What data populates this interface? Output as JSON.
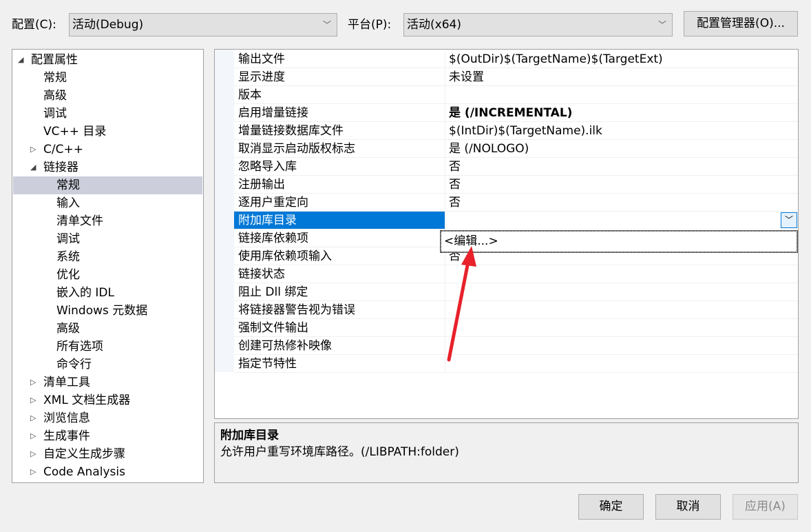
{
  "header": {
    "config_label": "配置(C):",
    "config_value": "活动(Debug)",
    "platform_label": "平台(P):",
    "platform_value": "活动(x64)",
    "config_manager": "配置管理器(O)..."
  },
  "tree": [
    {
      "label": "配置属性",
      "level": 0,
      "expander": "expanded"
    },
    {
      "label": "常规",
      "level": 1
    },
    {
      "label": "高级",
      "level": 1
    },
    {
      "label": "调试",
      "level": 1
    },
    {
      "label": "VC++ 目录",
      "level": 1
    },
    {
      "label": "C/C++",
      "level": 1,
      "expander": "collapsed"
    },
    {
      "label": "链接器",
      "level": 1,
      "expander": "expanded"
    },
    {
      "label": "常规",
      "level": 2,
      "selected": true
    },
    {
      "label": "输入",
      "level": 2
    },
    {
      "label": "清单文件",
      "level": 2
    },
    {
      "label": "调试",
      "level": 2
    },
    {
      "label": "系统",
      "level": 2
    },
    {
      "label": "优化",
      "level": 2
    },
    {
      "label": "嵌入的 IDL",
      "level": 2
    },
    {
      "label": "Windows 元数据",
      "level": 2
    },
    {
      "label": "高级",
      "level": 2
    },
    {
      "label": "所有选项",
      "level": 2
    },
    {
      "label": "命令行",
      "level": 2
    },
    {
      "label": "清单工具",
      "level": 1,
      "expander": "collapsed"
    },
    {
      "label": "XML 文档生成器",
      "level": 1,
      "expander": "collapsed"
    },
    {
      "label": "浏览信息",
      "level": 1,
      "expander": "collapsed"
    },
    {
      "label": "生成事件",
      "level": 1,
      "expander": "collapsed"
    },
    {
      "label": "自定义生成步骤",
      "level": 1,
      "expander": "collapsed"
    },
    {
      "label": "Code Analysis",
      "level": 1,
      "expander": "collapsed"
    }
  ],
  "properties": [
    {
      "name": "输出文件",
      "value": "$(OutDir)$(TargetName)$(TargetExt)"
    },
    {
      "name": "显示进度",
      "value": "未设置"
    },
    {
      "name": "版本",
      "value": ""
    },
    {
      "name": "启用增量链接",
      "value": "是 (/INCREMENTAL)",
      "bold": true
    },
    {
      "name": "增量链接数据库文件",
      "value": "$(IntDir)$(TargetName).ilk"
    },
    {
      "name": "取消显示启动版权标志",
      "value": "是 (/NOLOGO)"
    },
    {
      "name": "忽略导入库",
      "value": "否"
    },
    {
      "name": "注册输出",
      "value": "否"
    },
    {
      "name": "逐用户重定向",
      "value": "否"
    },
    {
      "name": "附加库目录",
      "value": "",
      "selected": true
    },
    {
      "name": "链接库依赖项",
      "value": ""
    },
    {
      "name": "使用库依赖项输入",
      "value": "否"
    },
    {
      "name": "链接状态",
      "value": ""
    },
    {
      "name": "阻止 Dll 绑定",
      "value": ""
    },
    {
      "name": "将链接器警告视为错误",
      "value": ""
    },
    {
      "name": "强制文件输出",
      "value": ""
    },
    {
      "name": "创建可热修补映像",
      "value": ""
    },
    {
      "name": "指定节特性",
      "value": ""
    }
  ],
  "dropdown": {
    "option": "<编辑...>"
  },
  "description": {
    "title": "附加库目录",
    "text": "允许用户重写环境库路径。(/LIBPATH:folder)"
  },
  "footer": {
    "ok": "确定",
    "cancel": "取消",
    "apply": "应用(A)"
  },
  "colors": {
    "selection": "#0078d7",
    "tree_selection": "#cccedb",
    "arrow": "#e8212b"
  }
}
